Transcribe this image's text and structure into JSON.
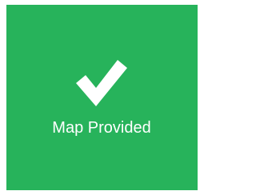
{
  "tile": {
    "label": "Map Provided",
    "icon": "checkmark-icon",
    "background_color": "#27b35b",
    "foreground_color": "#ffffff"
  }
}
